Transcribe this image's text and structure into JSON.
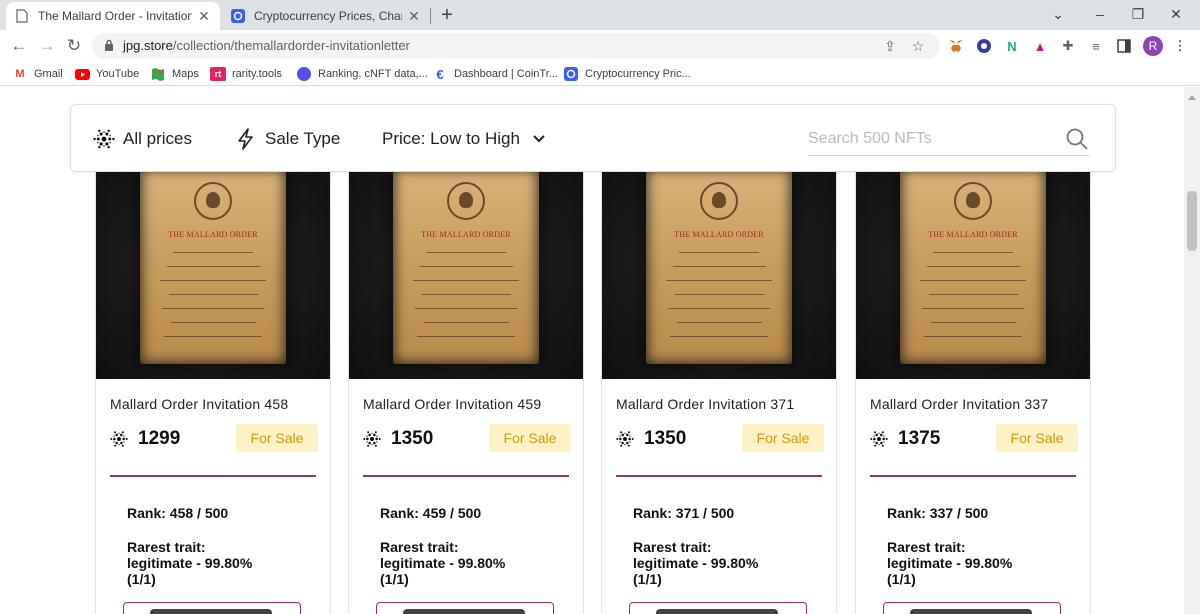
{
  "browser": {
    "tabs": [
      {
        "title": "The Mallard Order - Invitation Le",
        "active": true
      },
      {
        "title": "Cryptocurrency Prices, Charts An",
        "active": false
      }
    ],
    "new_tab_label": "+",
    "window_controls": {
      "tab_search": "⌄",
      "minimize": "–",
      "maximize": "❐",
      "close": "✕"
    },
    "url_host": "jpg.store",
    "url_path": "/collection/themallardorder-invitationletter",
    "profile_initial": "R",
    "bookmarks": [
      {
        "label": "Gmail",
        "icon": "gmail-icon",
        "color": "#ea4335"
      },
      {
        "label": "YouTube",
        "icon": "youtube-icon",
        "color": "#ff0000"
      },
      {
        "label": "Maps",
        "icon": "maps-icon",
        "color": "#34a853"
      },
      {
        "label": "rarity.tools",
        "icon": "rarity-tools-icon",
        "color": "#e0245e"
      },
      {
        "label": "Ranking, cNFT data,...",
        "icon": "ranking-icon",
        "color": "#5b4fe9"
      },
      {
        "label": "Dashboard | CoinTr...",
        "icon": "cointracking-icon",
        "color": "#3b5bdb"
      },
      {
        "label": "Cryptocurrency Pric...",
        "icon": "coinmarketcap-icon",
        "color": "#3861fb"
      }
    ]
  },
  "filters": {
    "all_prices": "All prices",
    "sale_type": "Sale Type",
    "sort": "Price: Low to High",
    "search_placeholder": "Search 500 NFTs"
  },
  "card_common": {
    "scroll_title": "THE MALLARD ORDER",
    "rarest_trait_label": "Rarest trait:",
    "accent_color": "#9a2a7a",
    "badge_color": "#fdf1c6"
  },
  "cards": [
    {
      "name": "Mallard Order Invitation 458",
      "price": "1299",
      "status": "For Sale",
      "rank": "Rank: 458 / 500",
      "trait": "legitimate - 99.80%",
      "trait_count": "(1/1)"
    },
    {
      "name": "Mallard Order Invitation 459",
      "price": "1350",
      "status": "For Sale",
      "rank": "Rank: 459 / 500",
      "trait": "legitimate - 99.80%",
      "trait_count": "(1/1)"
    },
    {
      "name": "Mallard Order Invitation 371",
      "price": "1350",
      "status": "For Sale",
      "rank": "Rank: 371 / 500",
      "trait": "legitimate - 99.80%",
      "trait_count": "(1/1)"
    },
    {
      "name": "Mallard Order Invitation 337",
      "price": "1375",
      "status": "For Sale",
      "rank": "Rank: 337 / 500",
      "trait": "legitimate - 99.80%",
      "trait_count": "(1/1)"
    }
  ]
}
